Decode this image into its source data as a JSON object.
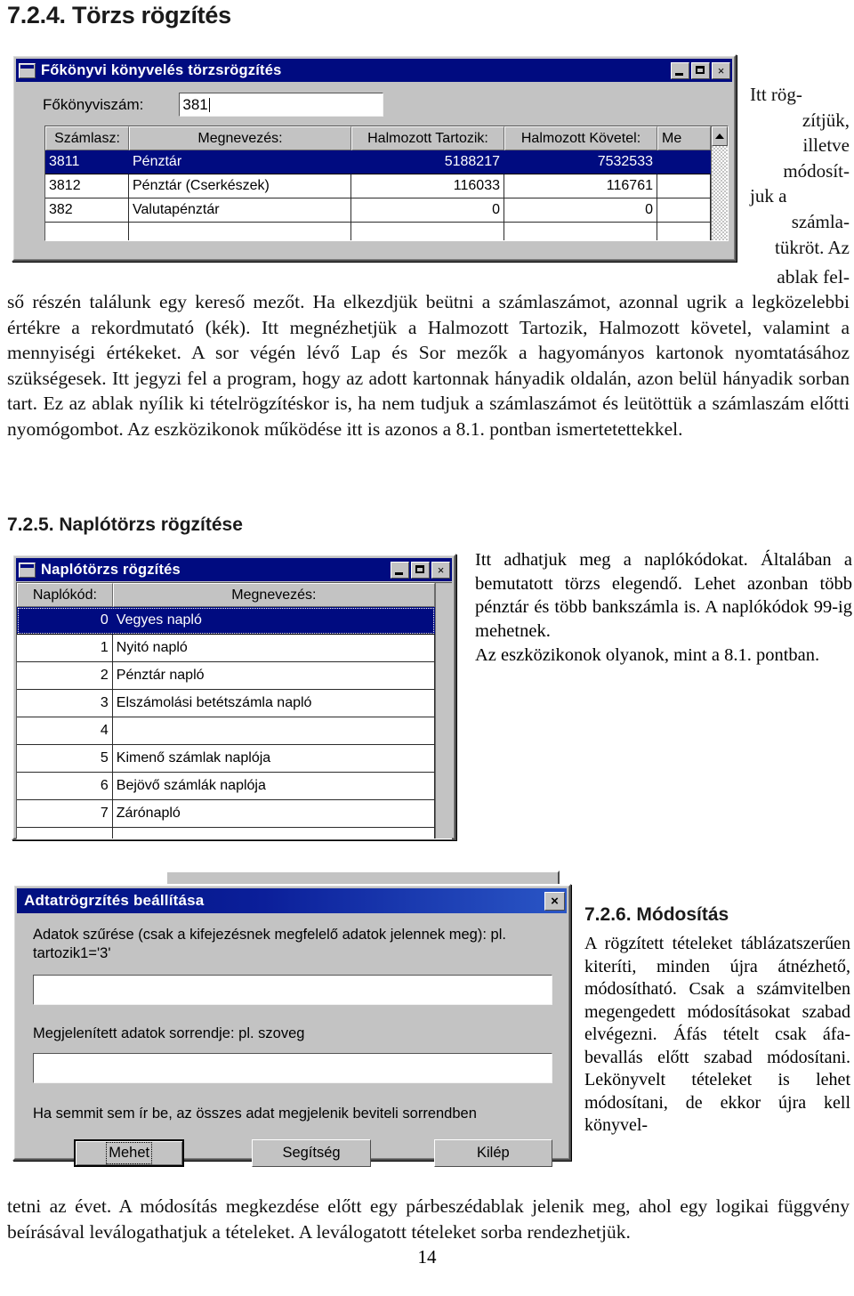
{
  "page": {
    "number": "14"
  },
  "section_724": {
    "heading": "7.2.4. Törzs rögzítés",
    "side_note": "Itt rögzítjük, illetve módosítjuk a számlatükröt. Az",
    "side_note_lines": [
      "Itt   rög-",
      "zítjük,",
      "illetve",
      "módosít-",
      "juk    a",
      "számla-",
      "tükröt. Az"
    ],
    "body_first_line": "ablak fel-",
    "body": "ső részén találunk egy kereső mezőt. Ha elkezdjük beütni a számlaszámot, azonnal ugrik a legközelebbi értékre a rekordmutató (kék). Itt megnézhetjük a Halmozott Tartozik, Halmozott követel, valamint a mennyiségi értékeket. A sor végén lévő Lap és Sor mezők a hagyományos kartonok nyomtatásához szükségesek. Itt jegyzi fel a program, hogy az adott kartonnak hányadik oldalán, azon belül hányadik sorban tart. Ez az ablak nyílik ki tételrögzítéskor is, ha nem tudjuk a számlaszámot és leütöttük a számlaszám előtti nyomógombot. Az eszközikonok működése itt is azonos a 8.1. pontban ismertetettekkel."
  },
  "window_fokonyvi": {
    "title": "Főkönyvi könyvelés törzsrögzítés",
    "icon": "window-icon",
    "minimize_label": "minimize-icon",
    "maximize_label": "maximize-icon",
    "close_label": "×",
    "field_label": "Főkönyviszám:",
    "field_value": "381",
    "columns": [
      "Számlasz:",
      "Megnevezés:",
      "Halmozott Tartozik:",
      "Halmozott Követel:",
      "Me"
    ],
    "rows": [
      {
        "szamlasz": "3811",
        "megnevezes": "Pénztár",
        "tartozik": "5188217",
        "kovetel": "7532533",
        "me": "",
        "selected": true
      },
      {
        "szamlasz": "3812",
        "megnevezes": "Pénztár (Cserkészek)",
        "tartozik": "116033",
        "kovetel": "116761",
        "me": "",
        "selected": false
      },
      {
        "szamlasz": "382",
        "megnevezes": "Valutapénztár",
        "tartozik": "0",
        "kovetel": "0",
        "me": "",
        "selected": false
      },
      {
        "szamlasz": "",
        "megnevezes": "",
        "tartozik": "",
        "kovetel": "",
        "me": "",
        "selected": false
      }
    ],
    "scroll_up_icon": "scroll-up-arrow"
  },
  "section_725": {
    "heading": "7.2.5. Naplótörzs rögzítése",
    "body": "Itt adhatjuk meg a naplókódokat. Általában a bemutatott törzs elegendő. Lehet azonban több pénztár és több bankszámla is. A naplókódok 99-ig mehetnek.",
    "body2": "Az eszközikonok olyanok, mint a 8.1. pontban."
  },
  "window_naplotorzs": {
    "title": "Naplótörzs rögzítés",
    "close_label": "×",
    "columns": [
      "Naplókód:",
      "Megnevezés:"
    ],
    "rows": [
      {
        "code": "0",
        "name": "Vegyes napló",
        "selected": true
      },
      {
        "code": "1",
        "name": "Nyitó napló",
        "selected": false
      },
      {
        "code": "2",
        "name": "Pénztár napló",
        "selected": false
      },
      {
        "code": "3",
        "name": "Elszámolási betétszámla napló",
        "selected": false
      },
      {
        "code": "4",
        "name": "",
        "selected": false
      },
      {
        "code": "5",
        "name": "Kimenő számlak naplója",
        "selected": false
      },
      {
        "code": "6",
        "name": "Bejövő számlák naplója",
        "selected": false
      },
      {
        "code": "7",
        "name": "Zárónapló",
        "selected": false
      },
      {
        "code": "",
        "name": "",
        "selected": false
      }
    ]
  },
  "window_adatrogzites": {
    "title": "Adtatrögrzítés beállítása",
    "close_label": "×",
    "filter_label_line1": "Adatok szűrése (csak a kifejezésnek megfelelő adatok jelennek meg): pl.",
    "filter_label_line2": "tartozik1='3'",
    "filter_value": "",
    "order_label": "Megjelenített adatok sorrendje: pl. szoveg",
    "order_value": "",
    "hint": "Ha semmit sem ír be, az összes adat megjelenik beviteli sorrendben",
    "buttons": {
      "ok": "Mehet",
      "help": "Segítség",
      "exit": "Kilép"
    }
  },
  "section_726": {
    "heading": "7.2.6. Módosítás",
    "body": "A rögzített tételeket táblázatszerűen kiteríti, minden újra átnézhető, módosítható. Csak a számvitelben megengedett módosításokat szabad elvégezni. Áfás tételt csak áfa-bevallás előtt szabad módosítani. Lekönyvelt tételeket is lehet módosítani, de ekkor újra kell könyvel-",
    "body_tail": "tetni az évet. A módosítás megkezdése előtt egy párbeszédablak jelenik meg, ahol egy logikai függvény beírásával leválogathatjuk a tételeket. A leválogatott tételeket sorba rendezhetjük."
  },
  "colors": {
    "titlebar": "#000b80",
    "window_face": "#c3c3c3",
    "selection": "#000b80"
  }
}
